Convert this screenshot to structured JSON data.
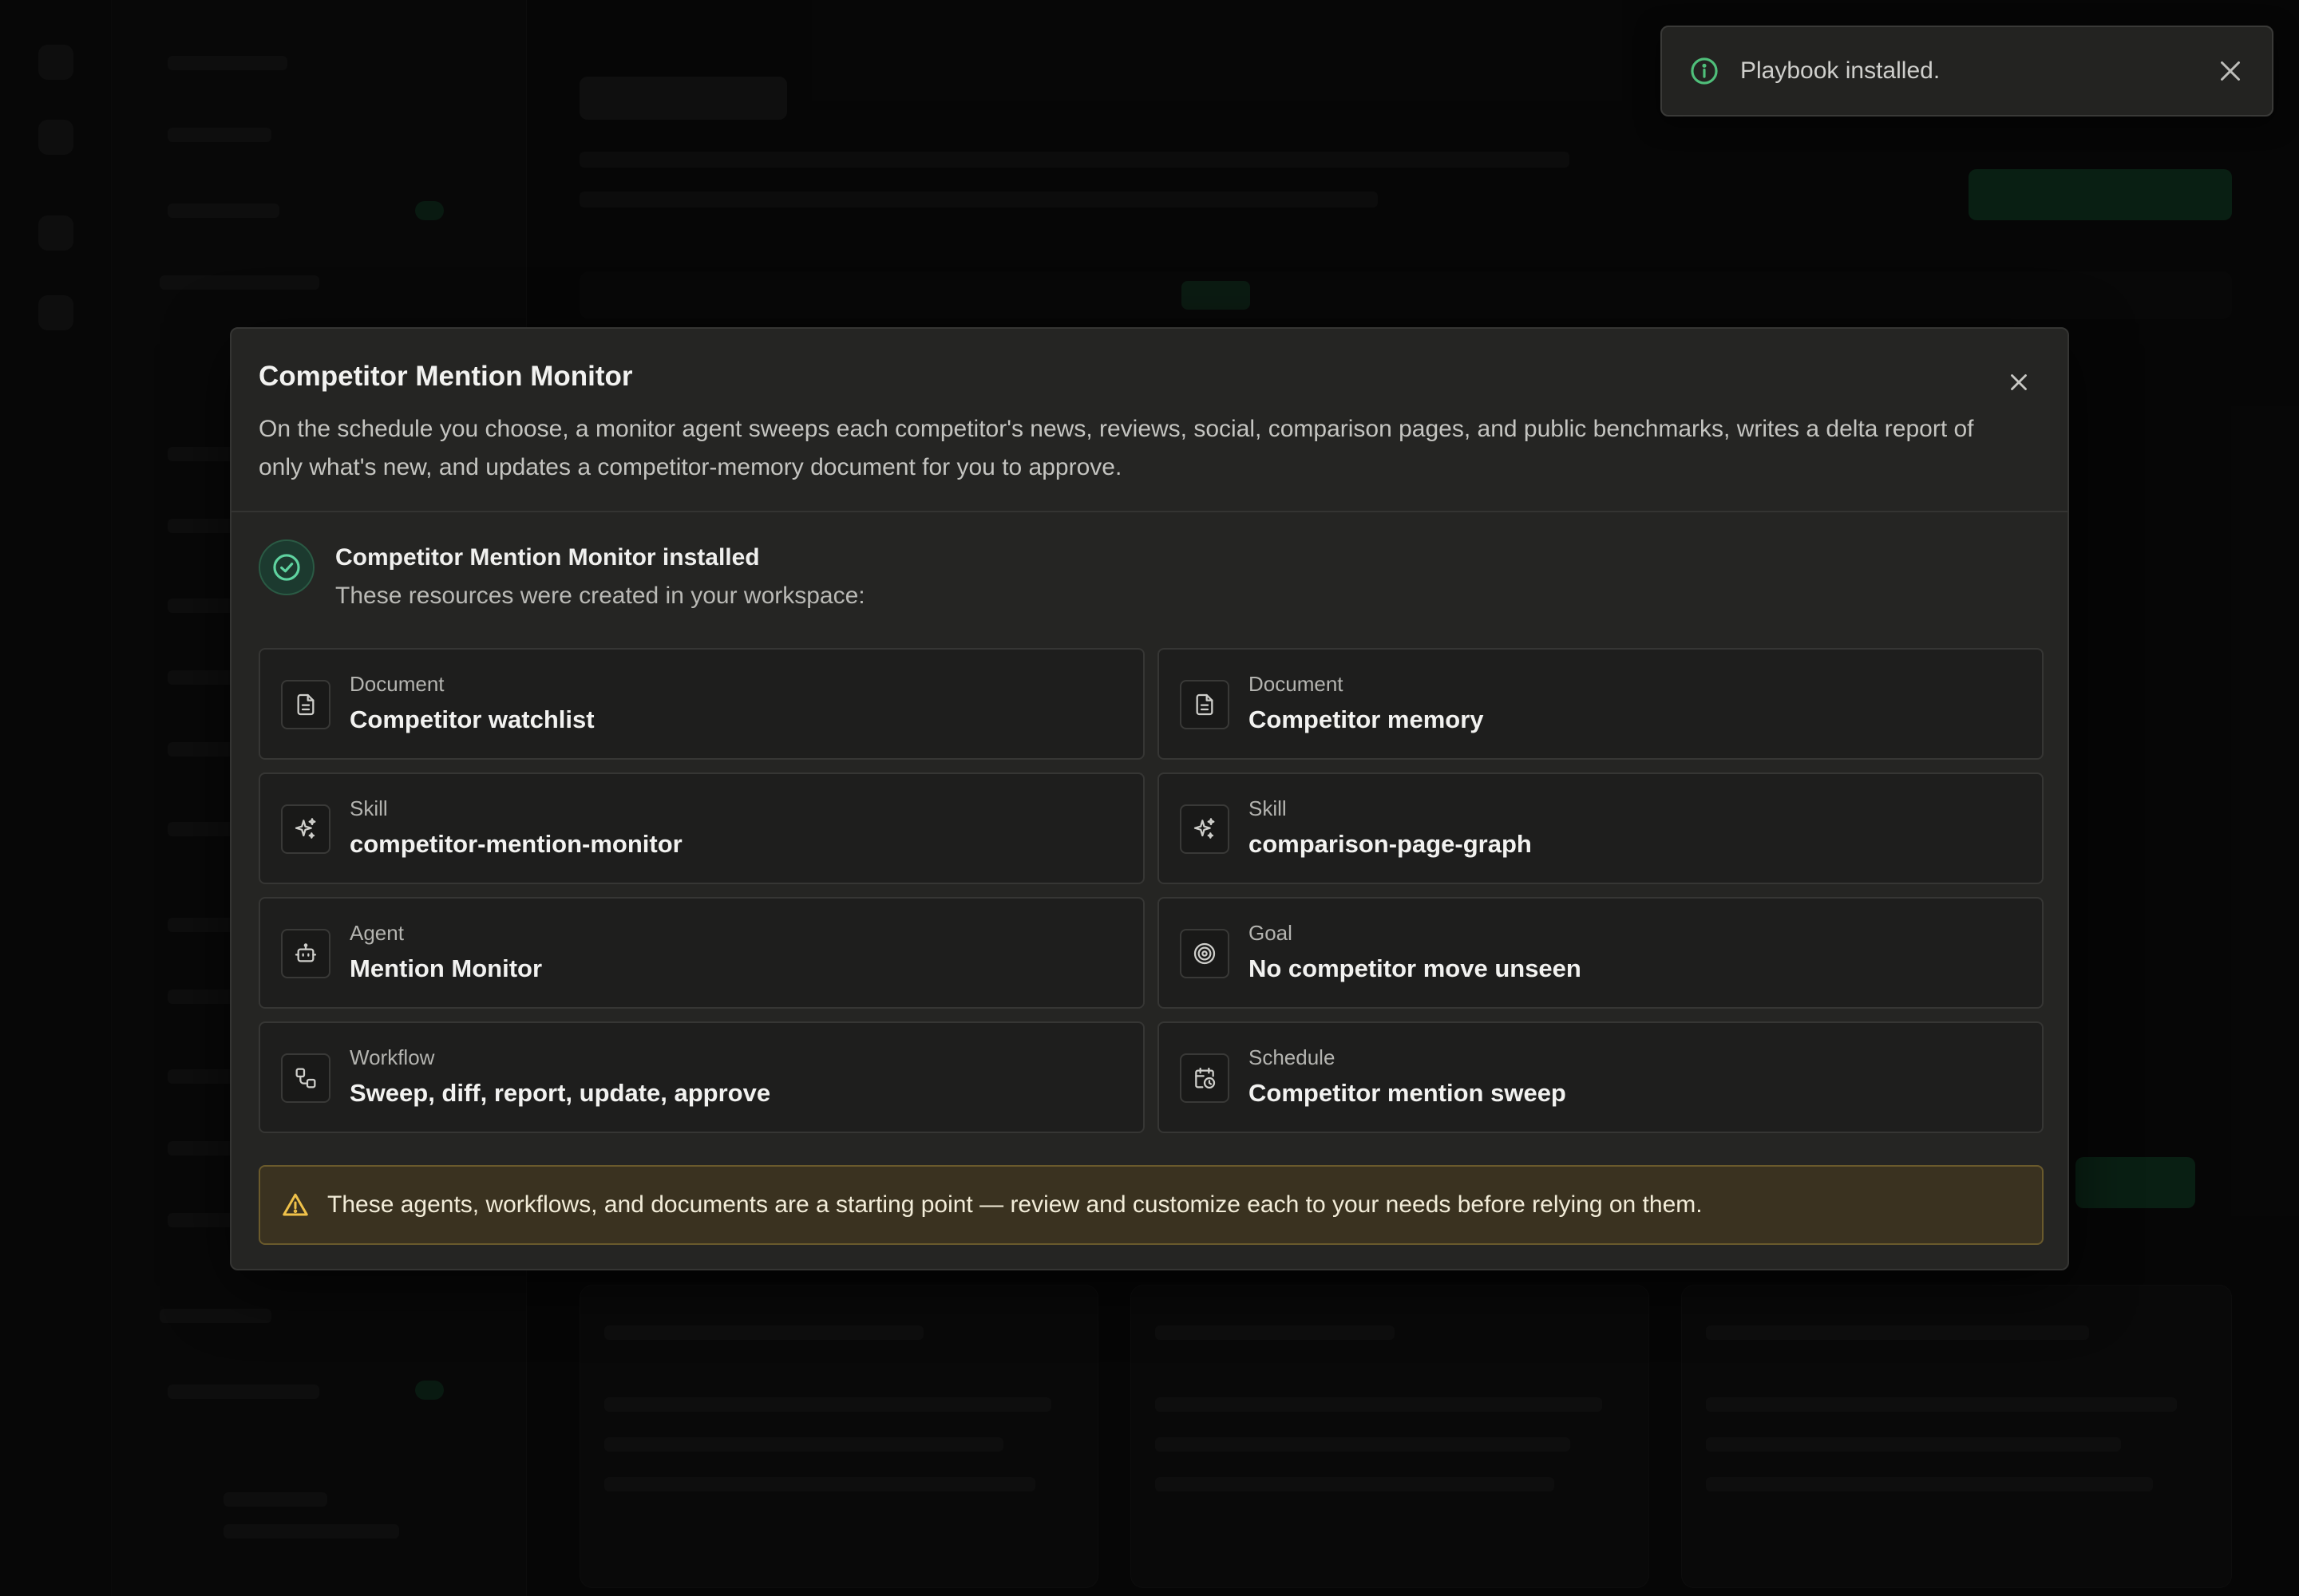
{
  "toast": {
    "message": "Playbook installed."
  },
  "modal": {
    "title": "Competitor Mention Monitor",
    "description": "On the schedule you choose, a monitor agent sweeps each competitor's news, reviews, social, comparison pages, and public benchmarks, writes a delta report of only what's new, and updates a competitor-memory document for you to approve.",
    "success_title": "Competitor Mention Monitor installed",
    "success_subtitle": "These resources were created in your workspace:",
    "resources": [
      {
        "kind": "Document",
        "name": "Competitor watchlist",
        "icon": "document-icon"
      },
      {
        "kind": "Document",
        "name": "Competitor memory",
        "icon": "document-icon"
      },
      {
        "kind": "Skill",
        "name": "competitor-mention-monitor",
        "icon": "sparkles-icon"
      },
      {
        "kind": "Skill",
        "name": "comparison-page-graph",
        "icon": "sparkles-icon"
      },
      {
        "kind": "Agent",
        "name": "Mention Monitor",
        "icon": "robot-icon"
      },
      {
        "kind": "Goal",
        "name": "No competitor move unseen",
        "icon": "target-icon"
      },
      {
        "kind": "Workflow",
        "name": "Sweep, diff, report, update, approve",
        "icon": "workflow-icon"
      },
      {
        "kind": "Schedule",
        "name": "Competitor mention sweep",
        "icon": "calendar-clock-icon"
      }
    ],
    "warning": "These agents, workflows, and documents are a starting point — review and customize each to your needs before relying on them."
  },
  "colors": {
    "success_accent": "#5fd3a0",
    "toast_info": "#4fbf7a",
    "warning_accent": "#f0c24a",
    "modal_bg": "#252523"
  }
}
